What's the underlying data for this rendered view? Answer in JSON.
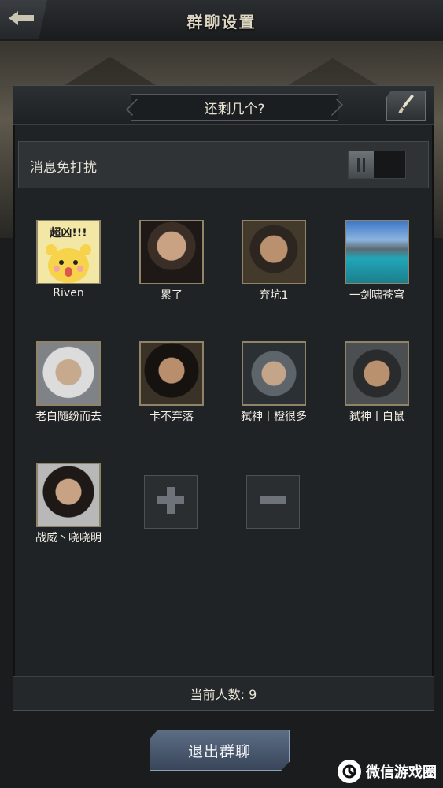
{
  "header": {
    "title": "群聊设置"
  },
  "group": {
    "name": "还剩几个?"
  },
  "settings": {
    "dnd_label": "消息免打扰"
  },
  "members": [
    {
      "name": "Riven",
      "avatar_text": "超凶!!!"
    },
    {
      "name": "累了"
    },
    {
      "name": "弃坑1"
    },
    {
      "name": "一剑啸苍穹"
    },
    {
      "name": "老白随纷而去"
    },
    {
      "name": "卡不弃落"
    },
    {
      "name": "弑神丨橙很多"
    },
    {
      "name": "弑神丨白鼠"
    },
    {
      "name": "战威丶哓哓明"
    }
  ],
  "footer": {
    "count_text": "当前人数: 9"
  },
  "exit_button": {
    "label": "退出群聊"
  },
  "watermark": {
    "text": "微信游戏圈"
  },
  "colors": {
    "panel": "#202325",
    "exit_button": "#4c5a70",
    "avatar_border": "#8f8467"
  }
}
